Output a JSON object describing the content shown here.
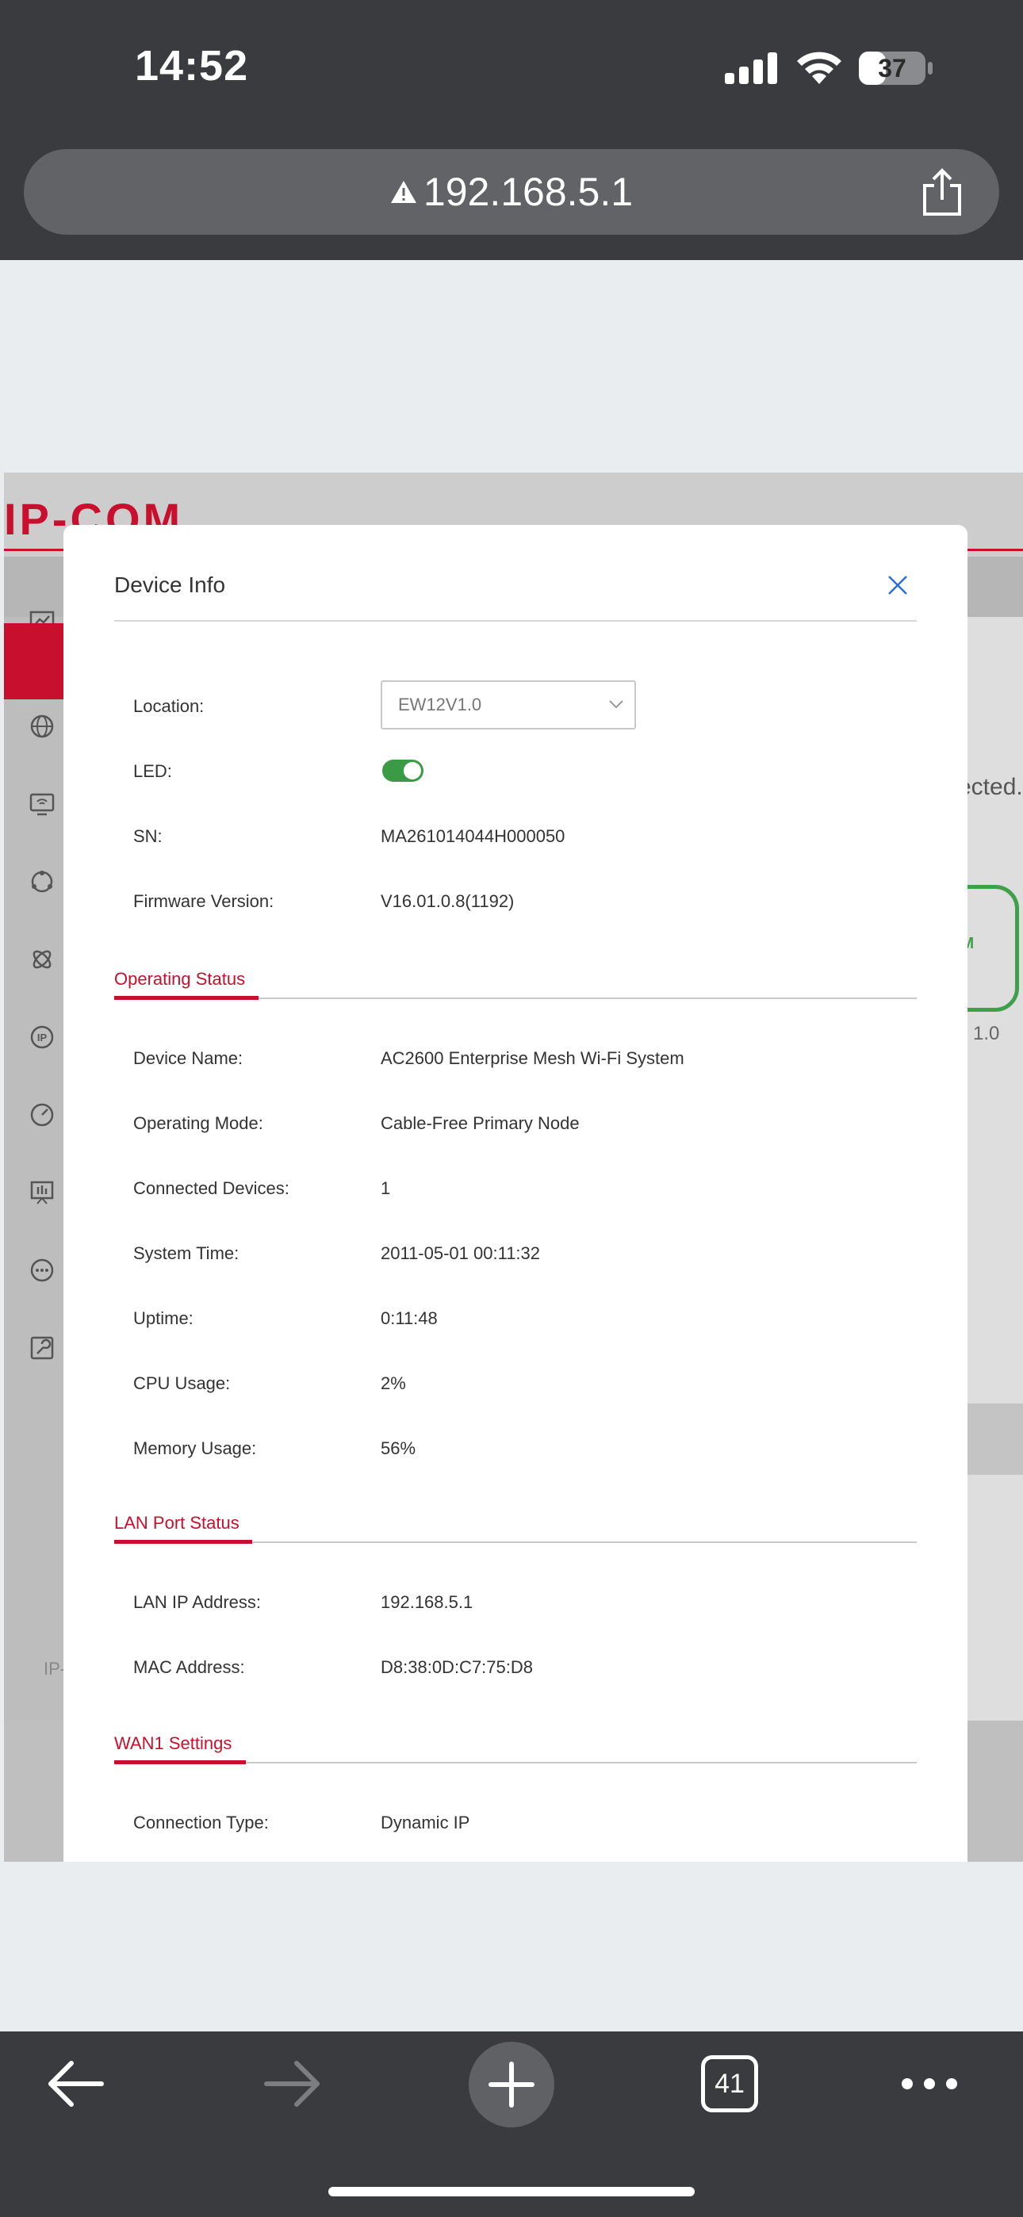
{
  "status_bar": {
    "time": "14:52",
    "battery": "37"
  },
  "browser": {
    "url": "192.168.5.1",
    "tab_count": "41"
  },
  "background_page": {
    "logo": "IP-COM",
    "right_fragment": "ected.",
    "card_fragment": "OM",
    "version_fragment": "1.0",
    "footer_fragment": "IP-"
  },
  "modal": {
    "title": "Device Info",
    "location": {
      "label": "Location:",
      "value": "EW12V1.0"
    },
    "led": {
      "label": "LED:",
      "on": true
    },
    "sn": {
      "label": "SN:",
      "value": "MA261014044H000050"
    },
    "firmware": {
      "label": "Firmware Version:",
      "value": "V16.01.0.8(1192)"
    },
    "operating_status": {
      "title": "Operating Status",
      "rows": [
        {
          "label": "Device Name:",
          "value": "AC2600 Enterprise Mesh Wi-Fi System"
        },
        {
          "label": "Operating Mode:",
          "value": "Cable-Free Primary Node"
        },
        {
          "label": "Connected Devices:",
          "value": "1"
        },
        {
          "label": "System Time:",
          "value": "2011-05-01 00:11:32"
        },
        {
          "label": "Uptime:",
          "value": "0:11:48"
        },
        {
          "label": "CPU Usage:",
          "value": "2%"
        },
        {
          "label": "Memory Usage:",
          "value": "56%"
        }
      ]
    },
    "lan_port_status": {
      "title": "LAN Port Status",
      "rows": [
        {
          "label": "LAN IP Address:",
          "value": "192.168.5.1"
        },
        {
          "label": "MAC Address:",
          "value": "D8:38:0D:C7:75:D8"
        }
      ]
    },
    "wan1_settings": {
      "title": "WAN1 Settings",
      "rows": [
        {
          "label": "Connection Type:",
          "value": "Dynamic IP"
        }
      ]
    }
  },
  "colors": {
    "accent": "#c8102e",
    "toggle_on": "#3a9a45",
    "link_blue": "#2a6fd6"
  }
}
